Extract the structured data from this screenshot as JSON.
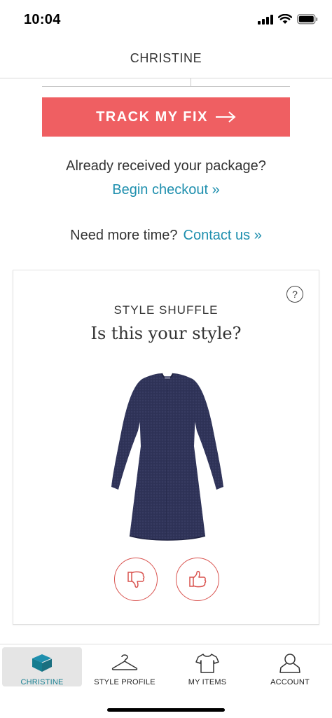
{
  "status_bar": {
    "time": "10:04"
  },
  "header": {
    "title": "CHRISTINE"
  },
  "track_button": {
    "label": "TRACK MY FIX",
    "arrow": "⟶"
  },
  "received": {
    "question": "Already received your package?",
    "link": "Begin checkout »"
  },
  "more_time": {
    "question": "Need more time?",
    "link": "Contact us »"
  },
  "style_shuffle": {
    "label": "STYLE SHUFFLE",
    "question": "Is this your style?",
    "help": "?"
  },
  "tabs": [
    {
      "label": "CHRISTINE",
      "icon": "box-icon",
      "active": true
    },
    {
      "label": "STYLE PROFILE",
      "icon": "hanger-icon",
      "active": false
    },
    {
      "label": "MY ITEMS",
      "icon": "shirt-icon",
      "active": false
    },
    {
      "label": "ACCOUNT",
      "icon": "person-icon",
      "active": false
    }
  ],
  "colors": {
    "accent_coral": "#ef5f62",
    "link_teal": "#1e8fae",
    "active_tab": "#147d90",
    "vote_red": "#d9534f"
  }
}
